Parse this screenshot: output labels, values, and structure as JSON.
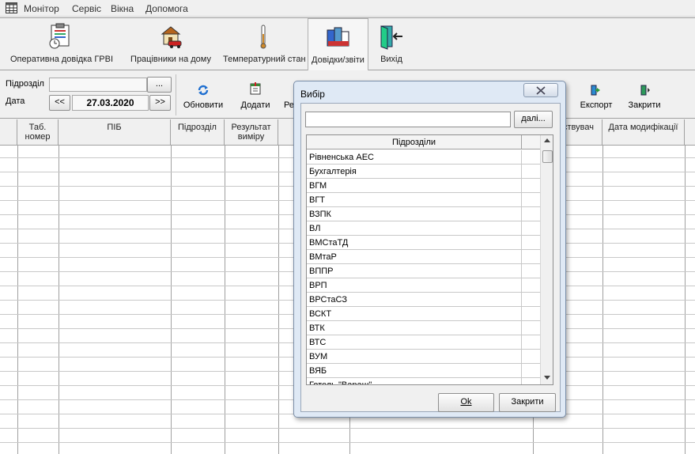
{
  "menu": {
    "items": [
      "Монітор",
      "Сервіс",
      "Вікна",
      "Допомога"
    ]
  },
  "toolbar": {
    "items": [
      {
        "label": "Оперативна довідка ГРВІ",
        "icon": "clipboard-report-icon"
      },
      {
        "label": "Працівники на дому",
        "icon": "house-car-icon"
      },
      {
        "label": "Температурний стан",
        "icon": "thermometer-icon"
      },
      {
        "label": "Довідки/звіти",
        "icon": "reports-icon"
      },
      {
        "label": "Вихід",
        "icon": "exit-door-icon"
      }
    ]
  },
  "filters": {
    "department_label": "Підрозділ",
    "department_value": "",
    "browse_label": "...",
    "date_label": "Дата",
    "date_value": "27.03.2020",
    "prev_label": "<<",
    "next_label": ">>"
  },
  "actions": {
    "refresh": "Обновити",
    "add": "Додати",
    "partial": "Ре",
    "export": "Експорт",
    "close": "Закрити"
  },
  "grid": {
    "headers": [
      "Таб. номер",
      "ПІБ",
      "Підрозділ",
      "Результат виміру",
      "ствувач",
      "Дата модифікації"
    ]
  },
  "dialog": {
    "title": "Вибір",
    "search_value": "",
    "next_button": "далі...",
    "list_header": "Підрозділи",
    "items": [
      "Рівненська АЕС",
      "Бухгалтерія",
      "ВГМ",
      "ВГТ",
      "ВЗПК",
      "ВЛ",
      "ВМСтаТД",
      "ВМтаР",
      "ВППР",
      "ВРП",
      "ВРСтаСЗ",
      "ВСКТ",
      "ВТК",
      "ВТС",
      "ВУМ",
      "ВЯБ",
      "Готель \"Вараш\""
    ],
    "ok_button": "Ok",
    "close_button": "Закрити"
  },
  "colors": {
    "dialog_frame": "#dfe9f5",
    "window_bg": "#f0f0f0",
    "grid_bg": "#ffffff"
  }
}
